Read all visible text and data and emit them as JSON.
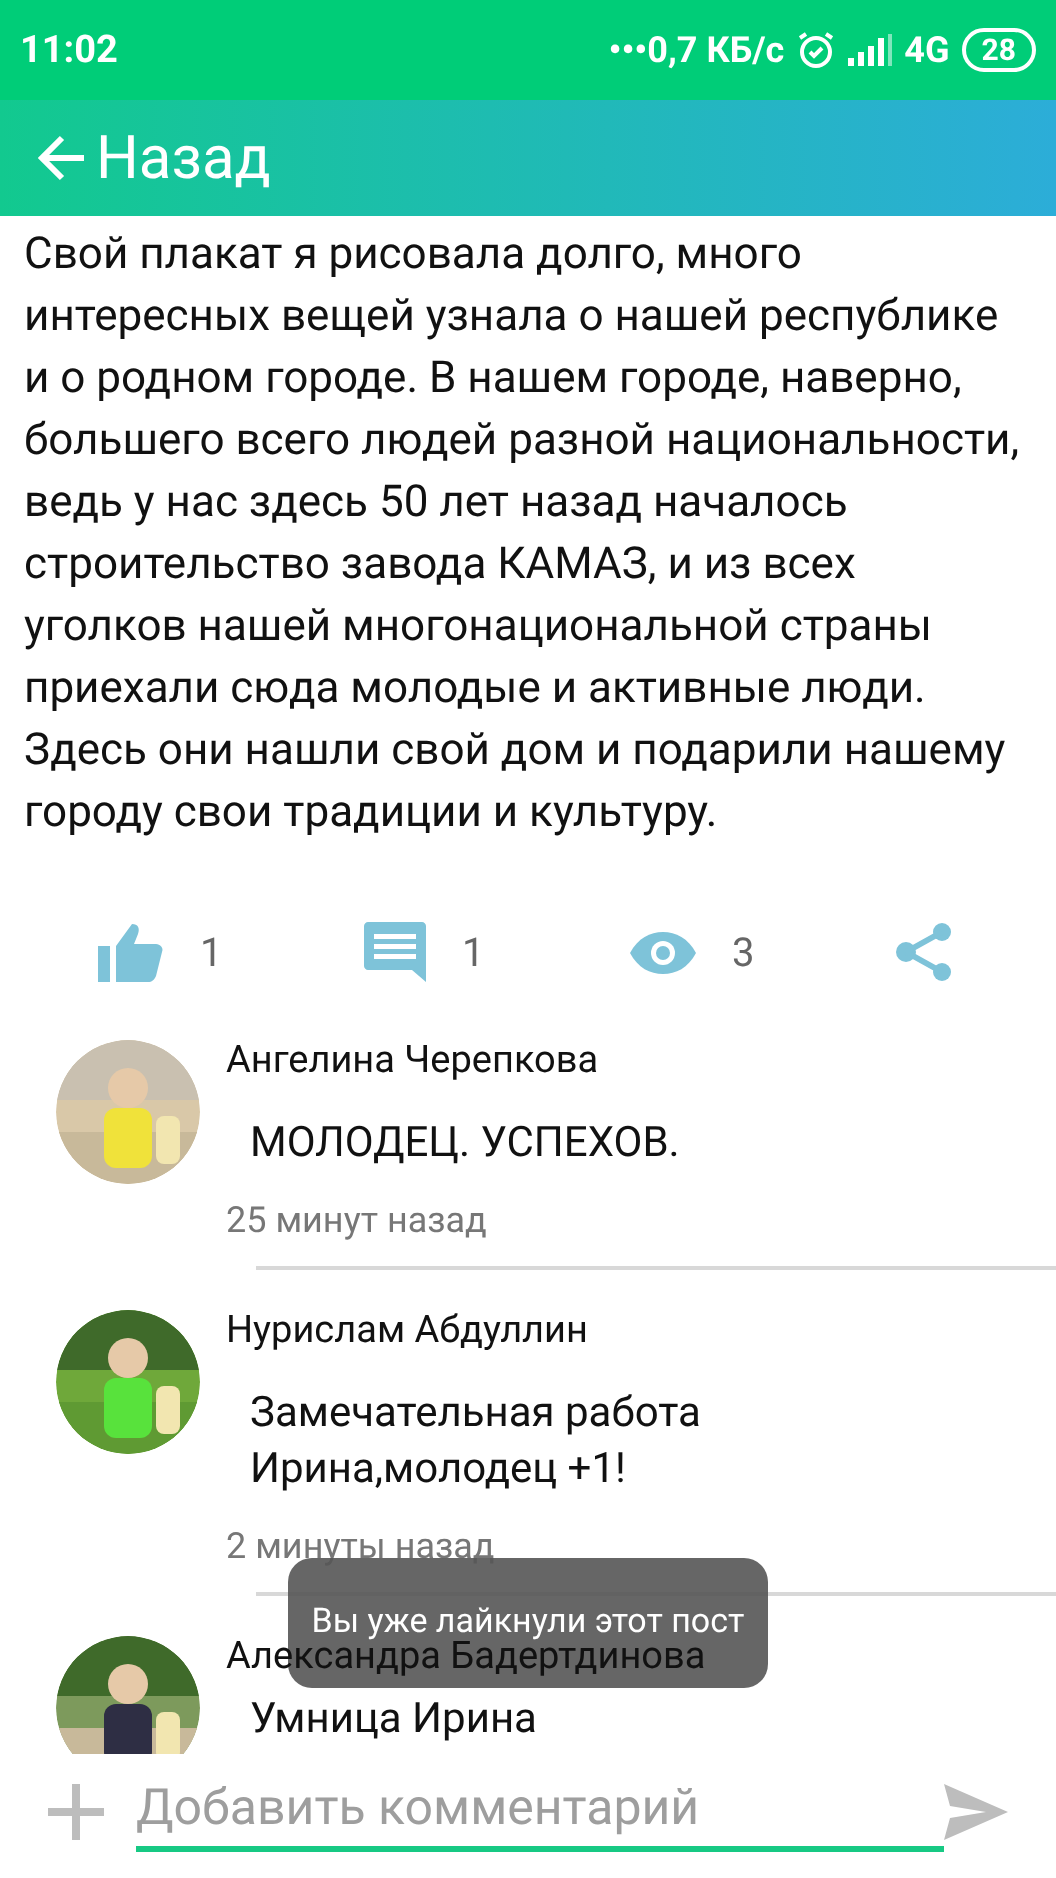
{
  "status_bar": {
    "time": "11:02",
    "notification_dots": "•••",
    "network_speed": "0,7 КБ/с",
    "network": "4G",
    "battery": "28"
  },
  "header": {
    "back_label": "Назад"
  },
  "post": {
    "text": "Свой плакат я рисовала долго, много интересных вещей узнала о нашей республике и о родном городе. В нашем городе, наверно, большего всего людей разной национальности, ведь у нас здесь 50 лет назад началось строительство завода КАМАЗ, и из всех уголков нашей многонациональной страны приехали сюда молодые и активные люди. Здесь они нашли свой дом и подарили нашему городу свои традиции и культуру.",
    "actions": [
      {
        "kind": "like",
        "count": "1"
      },
      {
        "kind": "comment",
        "count": "1"
      },
      {
        "kind": "views",
        "count": "3"
      },
      {
        "kind": "share"
      }
    ]
  },
  "comments": [
    {
      "author": "Ангелина Черепкова",
      "text": "МОЛОДЕЦ. УСПЕХОВ.",
      "time": "25 минут назад"
    },
    {
      "author": "Нурислам Абдуллин",
      "text": "Замечательная работа Ирина,молодец +1!",
      "time": "2 минуты назад"
    },
    {
      "author": "Александра Бадертдинова",
      "text": "Умница Ирина"
    }
  ],
  "toast": {
    "text": "Вы уже лайкнули этот пост"
  },
  "composer": {
    "placeholder": "Добавить комментарий"
  }
}
